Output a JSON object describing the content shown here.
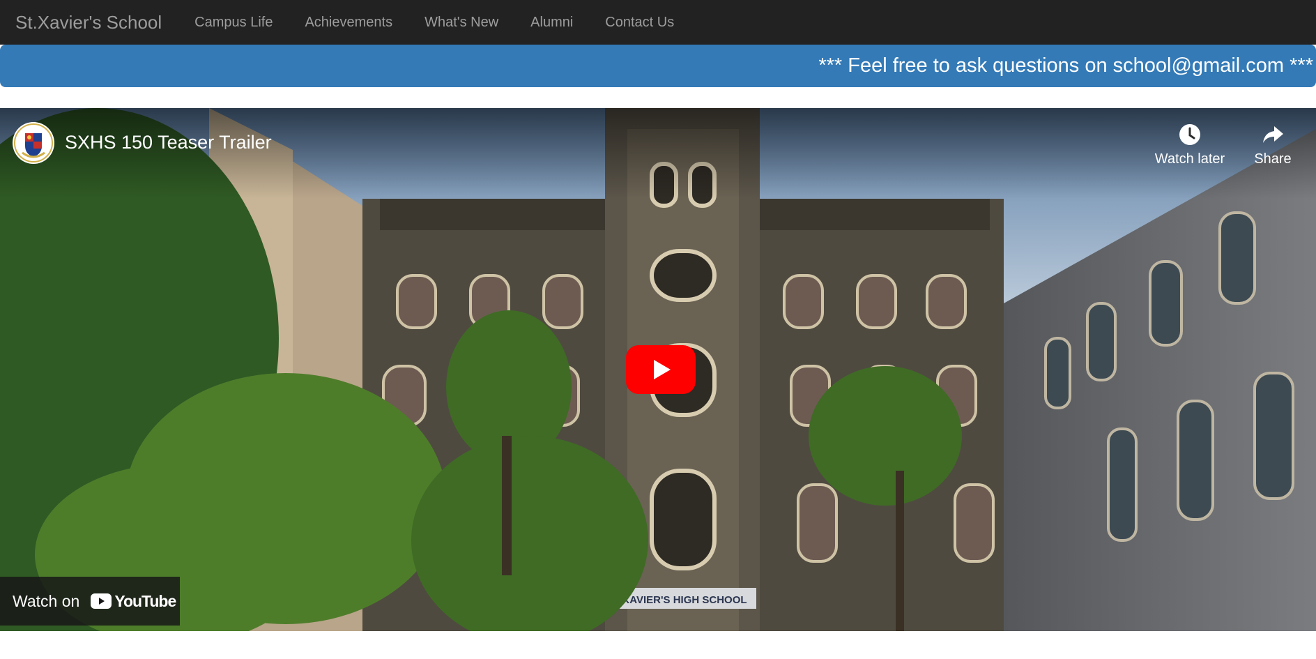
{
  "navbar": {
    "brand": "St.Xavier's School",
    "links": [
      {
        "label": "Campus Life"
      },
      {
        "label": "Achievements"
      },
      {
        "label": "What's New"
      },
      {
        "label": "Alumni"
      },
      {
        "label": "Contact Us"
      }
    ]
  },
  "banner": {
    "text": "*** Feel free to ask questions on school@gmail.com ***"
  },
  "video": {
    "title": "SXHS 150 Teaser Trailer",
    "watch_later_label": "Watch later",
    "share_label": "Share",
    "watch_on_label": "Watch on",
    "youtube_wordmark": "YouTube",
    "building_sign": "KAVIER'S HIGH SCHOOL"
  },
  "colors": {
    "navbar_bg": "#222222",
    "nav_text": "#9d9d9d",
    "banner_bg": "#337ab7",
    "play_red": "#ff0000"
  },
  "icons": [
    "channel-logo-icon",
    "clock-icon",
    "share-arrow-icon",
    "play-icon",
    "youtube-logo-icon"
  ]
}
